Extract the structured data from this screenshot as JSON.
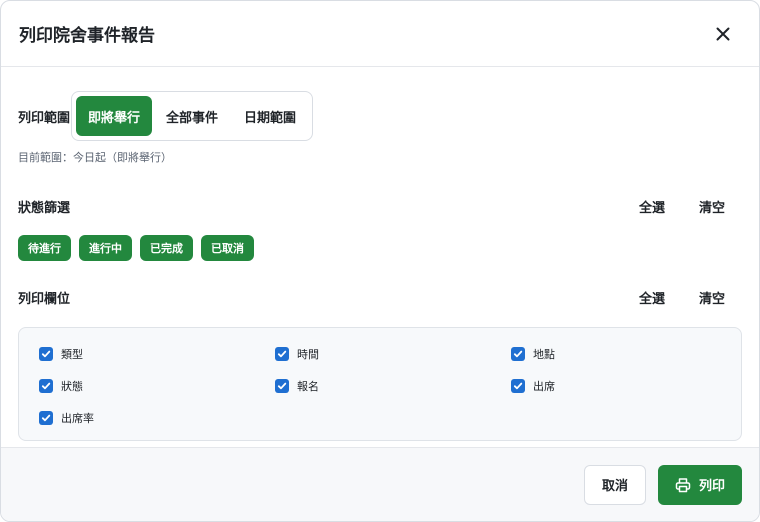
{
  "dialog": {
    "title": "列印院舍事件報告",
    "close_icon": "close-icon"
  },
  "range": {
    "label": "列印範圍",
    "options": [
      {
        "label": "即將舉行",
        "active": true
      },
      {
        "label": "全部事件",
        "active": false
      },
      {
        "label": "日期範圍",
        "active": false
      }
    ],
    "hint": "目前範圍：今日起（即將舉行）"
  },
  "status_filter": {
    "label": "狀態篩選",
    "select_all": "全選",
    "clear": "清空",
    "chips": [
      "待進行",
      "進行中",
      "已完成",
      "已取消"
    ]
  },
  "columns": {
    "label": "列印欄位",
    "select_all": "全選",
    "clear": "清空",
    "fields": [
      {
        "label": "類型",
        "checked": true
      },
      {
        "label": "時間",
        "checked": true
      },
      {
        "label": "地點",
        "checked": true
      },
      {
        "label": "狀態",
        "checked": true
      },
      {
        "label": "報名",
        "checked": true
      },
      {
        "label": "出席",
        "checked": true
      },
      {
        "label": "出席率",
        "checked": true
      }
    ]
  },
  "footer": {
    "cancel_label": "取消",
    "print_label": "列印",
    "print_icon": "printer-icon"
  },
  "colors": {
    "accent_green": "#23883e",
    "checkbox_blue": "#1f6fd1"
  }
}
